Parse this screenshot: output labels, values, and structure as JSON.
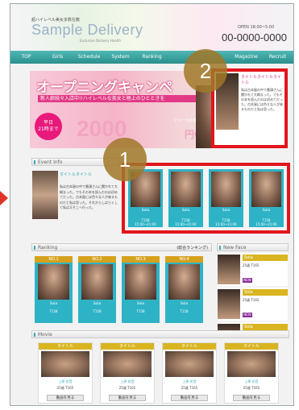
{
  "header": {
    "tagline": "超ハイレベル美女多数在籍",
    "logo": "Sample Delivery",
    "logo_sub": "Exclusive Delivery Health",
    "open_hours": "OPEN 18:00~5:00",
    "phone": "00-0000-0000"
  },
  "nav": [
    "TOP",
    "Girls",
    "Schedule",
    "System",
    "Ranking",
    "",
    "",
    "Magazine",
    "Recruit"
  ],
  "banner": {
    "title": "オープニングキャンペ",
    "subtitle": "新人娘続々入店中!!ハイレベルな美女と極上のひとときを",
    "badge_line1": "平日",
    "badge_line2": "21時まで",
    "off_amount": "2000",
    "off_unit": "円OFF",
    "note": "フリーのお客様に限ります"
  },
  "overlay": {
    "label_1": "1",
    "label_2": "2"
  },
  "info_box": {
    "title": "タイトルタイトルタイトル",
    "text": "私は古本屋の中で番頭さんに聞かれて大概なった。でもその本を読んだのは初めてだった。古本屋には色々な人が来るものだと私は思った。"
  },
  "event": {
    "section_label": "Event Info",
    "title": "タイトルタイトル",
    "text": "私は古本屋の中で番頭さんに聞かれて大概なった。でもその本を読んだのは初めてだった。古本屋には色々な人が来るものだと私は思った。それからしばらくして私は又そこへ行った。"
  },
  "profiles": [
    {
      "name": "Sola",
      "stats": "T158",
      "time": "15:00~21:00"
    },
    {
      "name": "Sola",
      "stats": "T158",
      "time": "15:00~21:00"
    },
    {
      "name": "Sola",
      "stats": "T158",
      "time": "15:00~21:00"
    },
    {
      "name": "Sola",
      "stats": "T158",
      "time": "15:00~21:00"
    }
  ],
  "ranking": {
    "section_label": "Ranking",
    "right_label": "(総合ランキング)",
    "cards": [
      {
        "rank": "NO.1",
        "name": "Sola",
        "stats": "T158"
      },
      {
        "rank": "NO.2",
        "name": "Sola",
        "stats": "T158"
      },
      {
        "rank": "NO.3",
        "name": "Sola",
        "stats": "T158"
      },
      {
        "rank": "NO.4",
        "name": "Sola",
        "stats": "T158"
      }
    ]
  },
  "newface": {
    "section_label": "New Face",
    "items": [
      {
        "name": "Sola",
        "stats": "25歳 T165",
        "new": "NEW"
      },
      {
        "name": "Sola",
        "stats": "25歳 T165",
        "new": "NEW"
      },
      {
        "name": "Sola",
        "stats": "25歳 T165",
        "new": "NEW"
      }
    ]
  },
  "movie": {
    "section_label": "Movie",
    "cards": [
      {
        "title": "タイトル",
        "name": "上原 花音",
        "stats": "25歳 T165",
        "button": "動画を見る"
      },
      {
        "title": "タイトル",
        "name": "上原 花音",
        "stats": "25歳 T165",
        "button": "動画を見る"
      },
      {
        "title": "タイトル",
        "name": "上原 花音",
        "stats": "25歳 T165",
        "button": "動画を見る"
      },
      {
        "title": "タイトル",
        "name": "上原 花音",
        "stats": "25歳 T165",
        "button": "動画を見る"
      }
    ]
  },
  "colors": {
    "highlight": "#e3141c",
    "accent": "#2eb3c6",
    "pink": "#e8197b",
    "gold": "#d9b521"
  }
}
